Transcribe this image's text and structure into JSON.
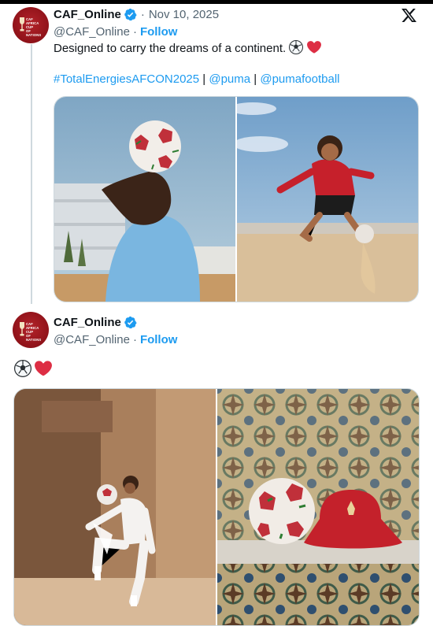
{
  "tweet1": {
    "display_name": "CAF_Online",
    "handle": "@CAF_Online",
    "separator": "·",
    "date": "Nov 10, 2025",
    "follow_label": "Follow",
    "text": "Designed to carry the dreams of a continent.",
    "emojis": [
      "soccer-ball",
      "red-heart"
    ],
    "hashtags": [
      "#TotalEnergiesAFCON2025",
      "@puma",
      "@pumafootball"
    ],
    "tag_separator": "|"
  },
  "tweet2": {
    "display_name": "CAF_Online",
    "handle": "@CAF_Online",
    "separator": "·",
    "follow_label": "Follow",
    "emojis": [
      "soccer-ball",
      "red-heart"
    ]
  },
  "colors": {
    "link": "#1d9bf0",
    "muted": "#536471",
    "text": "#0f1419",
    "border": "#cfd9de",
    "brand_red": "#b3232a"
  }
}
